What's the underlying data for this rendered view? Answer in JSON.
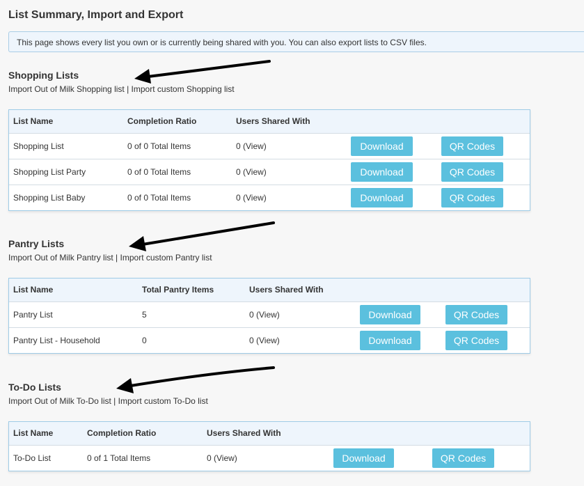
{
  "page_title": "List Summary, Import and Export",
  "info_text": "This page shows every list you own or is currently being shared with you. You can also export lists to CSV files.",
  "separator": "|",
  "sections": [
    {
      "title": "Shopping Lists",
      "import_milk": "Import Out of Milk Shopping list",
      "import_custom": "Import custom Shopping list",
      "headers": [
        "List Name",
        "Completion Ratio",
        "Users Shared With"
      ],
      "rows": [
        {
          "name": "Shopping List",
          "stat": "0 of 0 Total Items",
          "shared": "0 (View)"
        },
        {
          "name": "Shopping List Party",
          "stat": "0 of 0 Total Items",
          "shared": "0 (View)"
        },
        {
          "name": "Shopping List Baby",
          "stat": "0 of 0 Total Items",
          "shared": "0 (View)"
        }
      ]
    },
    {
      "title": "Pantry Lists",
      "import_milk": "Import Out of Milk Pantry list",
      "import_custom": "Import custom Pantry list",
      "headers": [
        "List Name",
        "Total Pantry Items",
        "Users Shared With"
      ],
      "rows": [
        {
          "name": "Pantry List",
          "stat": "5",
          "shared": "0 (View)"
        },
        {
          "name": "Pantry List - Household",
          "stat": "0",
          "shared": "0 (View)"
        }
      ]
    },
    {
      "title": "To-Do Lists",
      "import_milk": "Import Out of Milk To-Do list",
      "import_custom": "Import custom To-Do list",
      "headers": [
        "List Name",
        "Completion Ratio",
        "Users Shared With"
      ],
      "rows": [
        {
          "name": "To-Do List",
          "stat": "0 of 1 Total Items",
          "shared": "0 (View)"
        }
      ]
    }
  ],
  "buttons": {
    "download": "Download",
    "qr": "QR Codes"
  }
}
